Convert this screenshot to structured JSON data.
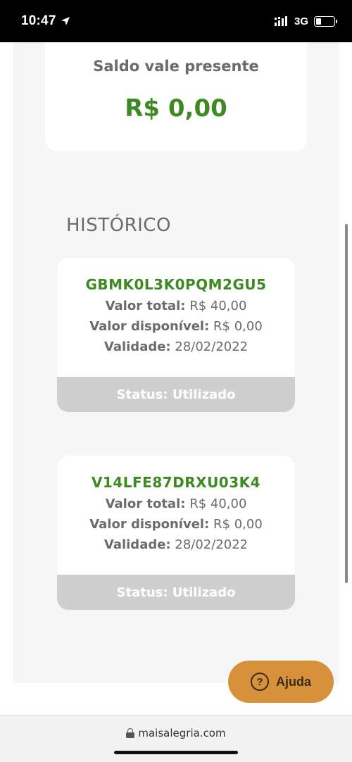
{
  "status_bar": {
    "time": "10:47",
    "network": "3G"
  },
  "balance": {
    "label": "Saldo vale presente",
    "value": "R$ 0,00"
  },
  "history": {
    "title": "HISTÓRICO",
    "vouchers": [
      {
        "code": "GBMK0L3K0PQM2GU5",
        "total_label": "Valor total:",
        "total_value": "R$ 40,00",
        "available_label": "Valor disponível:",
        "available_value": "R$ 0,00",
        "validity_label": "Validade:",
        "validity_value": "28/02/2022",
        "status": "Status: Utilizado"
      },
      {
        "code": "V14LFE87DRXU03K4",
        "total_label": "Valor total:",
        "total_value": "R$ 40,00",
        "available_label": "Valor disponível:",
        "available_value": "R$ 0,00",
        "validity_label": "Validade:",
        "validity_value": "28/02/2022",
        "status": "Status: Utilizado"
      }
    ]
  },
  "help_button": {
    "icon": "question-circle-icon",
    "label": "Ajuda"
  },
  "browser": {
    "url": "maisalegria.com"
  },
  "colors": {
    "green": "#3e8a22",
    "help": "#d6913a",
    "status_gray": "#cfcfcf"
  }
}
